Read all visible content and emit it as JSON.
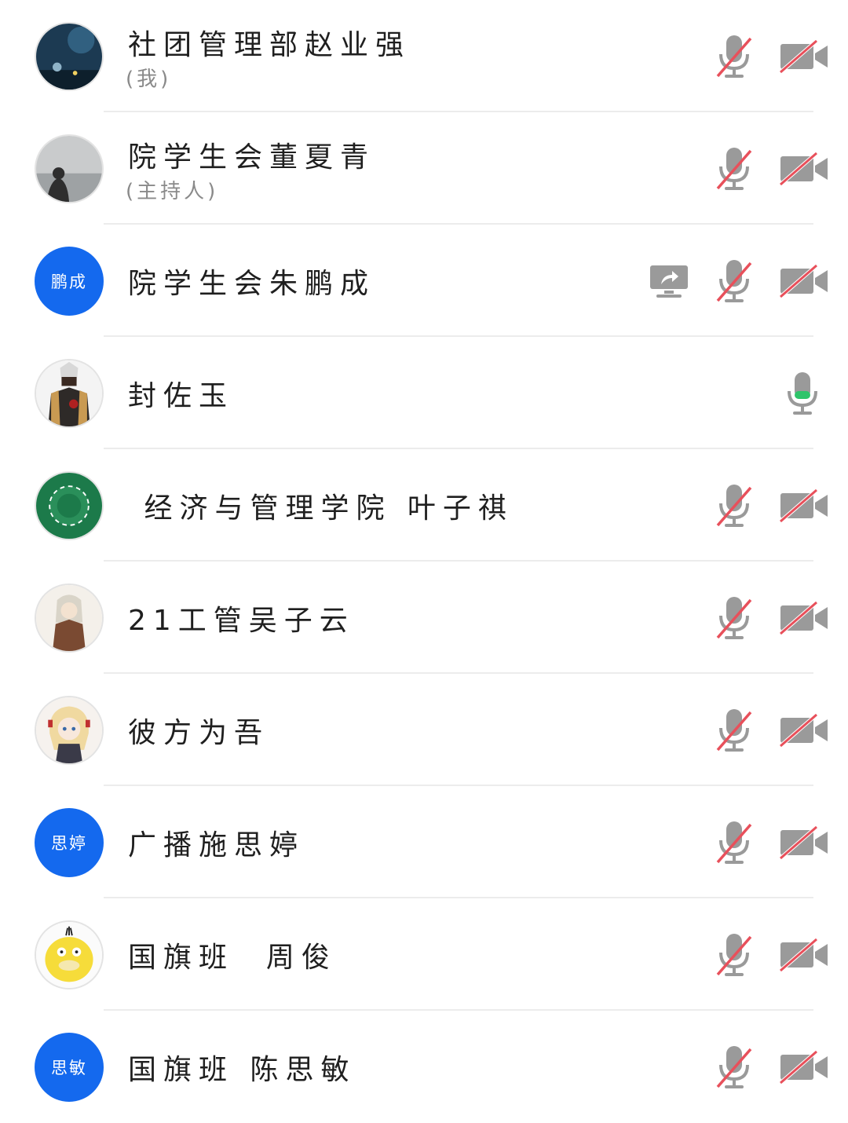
{
  "participants": [
    {
      "name": "社团管理部赵业强",
      "role": "(我)",
      "avatar_text": null,
      "mic": "muted",
      "camera": "off",
      "sharing": false
    },
    {
      "name": "院学生会董夏青",
      "role": "(主持人)",
      "avatar_text": null,
      "mic": "muted",
      "camera": "off",
      "sharing": false
    },
    {
      "name": "院学生会朱鹏成",
      "role": null,
      "avatar_text": "鹏成",
      "mic": "muted",
      "camera": "off",
      "sharing": true
    },
    {
      "name": "封佐玉",
      "role": null,
      "avatar_text": null,
      "mic": "active",
      "camera": "none",
      "sharing": false
    },
    {
      "name": " 经济与管理学院 叶子祺",
      "role": null,
      "avatar_text": null,
      "mic": "muted",
      "camera": "off",
      "sharing": false
    },
    {
      "name": "21工管吴子云",
      "role": null,
      "avatar_text": null,
      "mic": "muted",
      "camera": "off",
      "sharing": false
    },
    {
      "name": "彼方为吾",
      "role": null,
      "avatar_text": null,
      "mic": "muted",
      "camera": "off",
      "sharing": false
    },
    {
      "name": "广播施思婷",
      "role": null,
      "avatar_text": "思婷",
      "mic": "muted",
      "camera": "off",
      "sharing": false
    },
    {
      "name": "国旗班  周俊",
      "role": null,
      "avatar_text": null,
      "mic": "muted",
      "camera": "off",
      "sharing": false
    },
    {
      "name": "国旗班 陈思敏",
      "role": null,
      "avatar_text": "思敏",
      "mic": "muted",
      "camera": "off",
      "sharing": false
    }
  ],
  "colors": {
    "accent": "#1469ee",
    "muted_slash": "#e8505b",
    "icon_gray": "#9a9a9a",
    "speaking": "#2fc46b"
  }
}
